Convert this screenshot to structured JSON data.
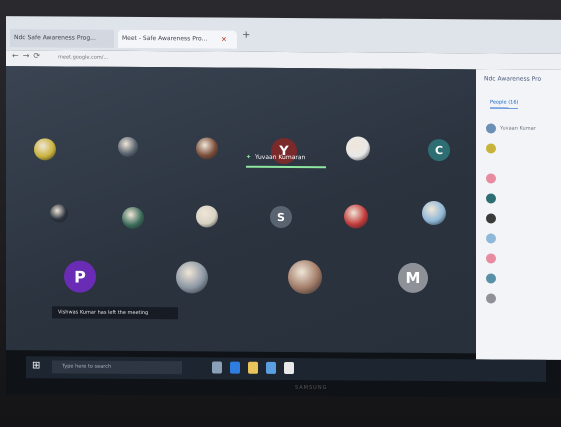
{
  "browser": {
    "tabs": [
      {
        "label": "Ndc Safe Awareness Prog..."
      },
      {
        "label": "Meet - Safe Awareness Pro..."
      }
    ],
    "address": "meet.google.com/..."
  },
  "meeting": {
    "speaking_name": "Yuvaan Kumaran",
    "toast": "Vishwas Kumar has left the meeting",
    "tiles": [
      {
        "letter": "",
        "color": "#c9b23a"
      },
      {
        "letter": "",
        "color": "#5c6672"
      },
      {
        "letter": "",
        "color": "#7a4d3a"
      },
      {
        "letter": "Y",
        "color": "#7a2a2a"
      },
      {
        "letter": "",
        "color": "#e8e8e8"
      },
      {
        "letter": "C",
        "color": "#2e6e73"
      },
      {
        "letter": "",
        "color": "#2b333f"
      },
      {
        "letter": "",
        "color": "#3a6b5a"
      },
      {
        "letter": "",
        "color": "#d8d2c4"
      },
      {
        "letter": "S",
        "color": "#5a6470"
      },
      {
        "letter": "",
        "color": "#c23b3b"
      },
      {
        "letter": "",
        "color": "#8fb8d8"
      },
      {
        "letter": "P",
        "color": "#6a2bb5"
      },
      {
        "letter": "",
        "color": "#8a96a3"
      },
      {
        "letter": "",
        "color": "#a07a66"
      },
      {
        "letter": "M",
        "color": "#8e9298"
      }
    ]
  },
  "sidebar": {
    "title": "Ndc Awareness Pro",
    "tab_label": "People (16)",
    "rows": [
      {
        "name": "Yuvaan Kumar",
        "color": "#6b8fb5"
      },
      {
        "name": "",
        "color": "#c9b23a"
      },
      {
        "name": "",
        "color": "#e88aa0"
      },
      {
        "name": "",
        "color": "#2e6e73"
      },
      {
        "name": "",
        "color": "#3a3a3a"
      },
      {
        "name": "",
        "color": "#8fb8d8"
      },
      {
        "name": "",
        "color": "#e88aa0"
      },
      {
        "name": "",
        "color": "#5a8fa8"
      },
      {
        "name": "",
        "color": "#8e9298"
      }
    ]
  },
  "taskbar": {
    "search_placeholder": "Type here to search",
    "icons": [
      "task-view",
      "edge",
      "explorer",
      "store",
      "chrome"
    ]
  },
  "monitor": {
    "brand": "SAMSUNG"
  }
}
